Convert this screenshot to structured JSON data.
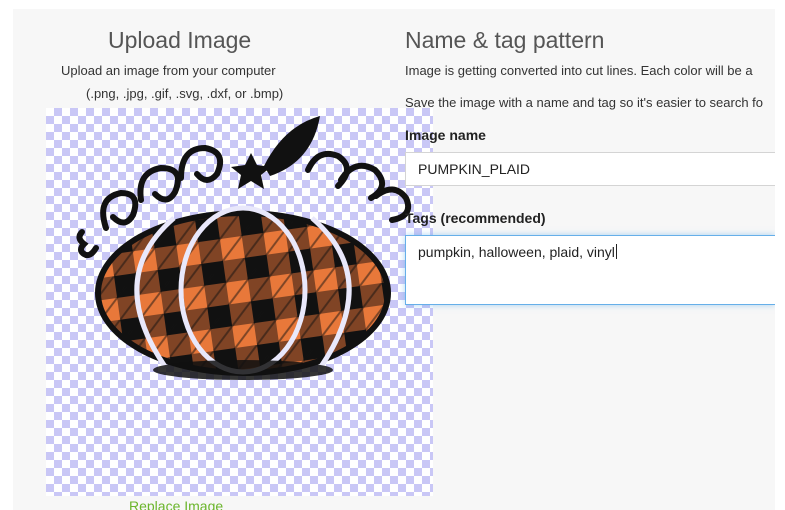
{
  "upload": {
    "title": "Upload Image",
    "subtitle": "Upload an image from your computer",
    "formats": "(.png, .jpg, .gif, .svg, .dxf, or .bmp)",
    "replace_label": "Replace Image"
  },
  "pattern": {
    "title": "Name & tag pattern",
    "desc1": "Image is getting converted into cut lines. Each color will be a",
    "desc2": "Save the image with a name and tag so it's easier to search fo",
    "name_label": "Image name",
    "name_value": "PUMPKIN_PLAID",
    "tags_label": "Tags (recommended)",
    "tags_value": "pumpkin, halloween, plaid, vinyl"
  },
  "colors": {
    "accent_green": "#6bb52c",
    "checker": "#c9c7f6",
    "plaid_orange": "#e8783a",
    "focus_blue": "#66afe9"
  }
}
